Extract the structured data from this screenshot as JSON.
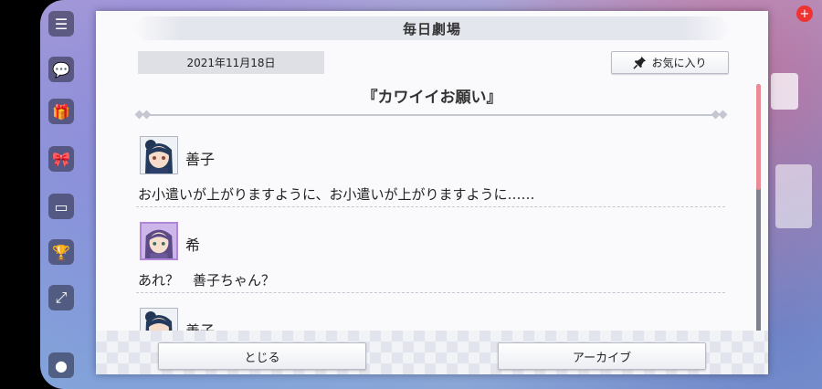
{
  "dialog": {
    "title": "毎日劇場",
    "date": "2021年11月18日",
    "favorite_label": "お気に入り",
    "episode_title": "『カワイイお願い』"
  },
  "entries": [
    {
      "speaker": "善子",
      "text": "お小遣いが上がりますように、お小遣いが上がりますように……"
    },
    {
      "speaker": "希",
      "text": "あれ？　善子ちゃん？"
    },
    {
      "speaker": "善子",
      "text": ""
    }
  ],
  "buttons": {
    "close_label": "とじる",
    "archive_label": "アーカイブ"
  },
  "scroll": {
    "position_fraction": 0.0,
    "visible_fraction": 0.42
  },
  "colors": {
    "accent_pink": "#e98a97",
    "dialog_bg": "#fafafc",
    "date_bg": "#dfe0e6"
  },
  "icons": {
    "favorite": "pin-icon",
    "side_menu": "menu-icon"
  }
}
